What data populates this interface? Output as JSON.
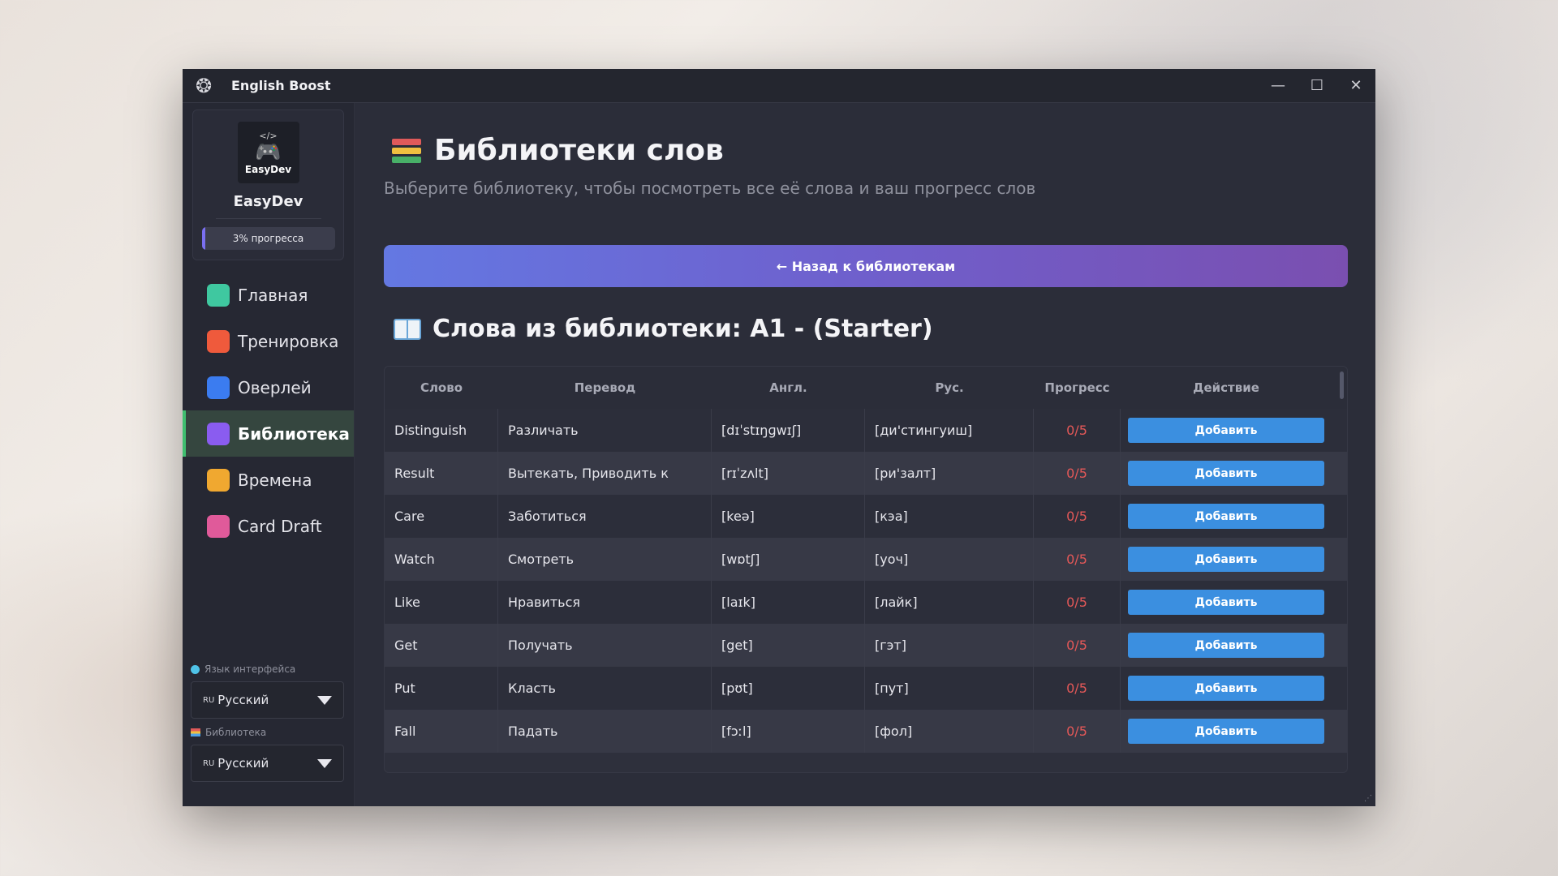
{
  "app": {
    "title": "English Boost"
  },
  "profile": {
    "avatar_code": "</>",
    "avatar_label": "EasyDev",
    "name": "EasyDev",
    "progress_label": "3% прогресса",
    "progress_fraction": 0.03,
    "progress_color": "#7a6ff0"
  },
  "nav": {
    "items": [
      {
        "label": "Главная",
        "icon": "home-icon",
        "color": "#3fc8a0",
        "active": false
      },
      {
        "label": "Тренировка",
        "icon": "play-icon",
        "color": "#ef5a3c",
        "active": false
      },
      {
        "label": "Оверлей",
        "icon": "overlay-icon",
        "color": "#3b7cf0",
        "active": false
      },
      {
        "label": "Библиотека",
        "icon": "books-icon",
        "color": "#8a5cf0",
        "active": true
      },
      {
        "label": "Времена",
        "icon": "clock-icon",
        "color": "#f0a830",
        "active": false
      },
      {
        "label": "Card Draft",
        "icon": "cards-icon",
        "color": "#e05a9a",
        "active": false
      }
    ]
  },
  "settings": {
    "ui_language_label": "Язык интерфейса",
    "ui_language_flag": "RU",
    "ui_language_value": "Русский",
    "library_label": "Библиотека",
    "library_flag": "RU",
    "library_value": "Русский"
  },
  "main": {
    "title": "Библиотеки слов",
    "subtitle": "Выберите библиотеку, чтобы посмотреть все её слова и ваш прогресс слов",
    "back_button": "← Назад к библиотекам",
    "section_title": "Слова из библиотеки: A1 - (Starter)"
  },
  "table": {
    "headers": [
      "Слово",
      "Перевод",
      "Англ.",
      "Рус.",
      "Прогресс",
      "Действие"
    ],
    "rows": [
      {
        "word": "Distinguish",
        "translation": "Различать",
        "en": "[dɪˈstɪŋɡwɪʃ]",
        "ru": "[ди'стингуиш]",
        "progress": "0/5",
        "action": "Добавить"
      },
      {
        "word": "Result",
        "translation": "Вытекать, Приводить к",
        "en": "[rɪˈzʌlt]",
        "ru": "[ри'залт]",
        "progress": "0/5",
        "action": "Добавить"
      },
      {
        "word": "Care",
        "translation": "Заботиться",
        "en": "[keə]",
        "ru": "[кэа]",
        "progress": "0/5",
        "action": "Добавить"
      },
      {
        "word": "Watch",
        "translation": "Смотреть",
        "en": "[wɒtʃ]",
        "ru": "[уоч]",
        "progress": "0/5",
        "action": "Добавить"
      },
      {
        "word": "Like",
        "translation": "Нравиться",
        "en": "[laɪk]",
        "ru": "[лайк]",
        "progress": "0/5",
        "action": "Добавить"
      },
      {
        "word": "Get",
        "translation": "Получать",
        "en": "[get]",
        "ru": "[гэт]",
        "progress": "0/5",
        "action": "Добавить"
      },
      {
        "word": "Put",
        "translation": "Класть",
        "en": "[pʊt]",
        "ru": "[пут]",
        "progress": "0/5",
        "action": "Добавить"
      },
      {
        "word": "Fall",
        "translation": "Падать",
        "en": "[fɔːl]",
        "ru": "[фол]",
        "progress": "0/5",
        "action": "Добавить"
      }
    ]
  }
}
